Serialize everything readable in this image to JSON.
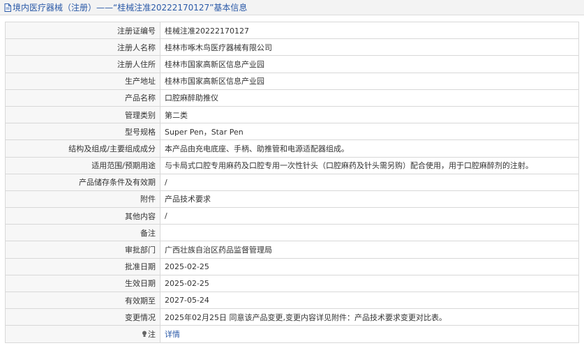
{
  "header": {
    "title": "境内医疗器械（注册）——“桂械注准20222170127”基本信息"
  },
  "rows": [
    {
      "label": "注册证编号",
      "value": "桂械注准20222170127"
    },
    {
      "label": "注册人名称",
      "value": "桂林市啄木鸟医疗器械有限公司"
    },
    {
      "label": "注册人住所",
      "value": "桂林市国家高新区信息产业园"
    },
    {
      "label": "生产地址",
      "value": "桂林市国家高新区信息产业园"
    },
    {
      "label": "产品名称",
      "value": "口腔麻醉助推仪"
    },
    {
      "label": "管理类别",
      "value": "第二类"
    },
    {
      "label": "型号规格",
      "value": "Super Pen，Star Pen"
    },
    {
      "label": "结构及组成/主要组成成分",
      "value": "本产品由充电底座、手柄、助推管和电源适配器组成。"
    },
    {
      "label": "适用范围/预期用途",
      "value": "与卡局式口腔专用麻药及口腔专用一次性针头（口腔麻药及针头需另购）配合使用，用于口腔麻醉剂的注射。"
    },
    {
      "label": "产品储存条件及有效期",
      "value": "/"
    },
    {
      "label": "附件",
      "value": "产品技术要求"
    },
    {
      "label": "其他内容",
      "value": "/"
    },
    {
      "label": "备注",
      "value": ""
    },
    {
      "label": "审批部门",
      "value": "广西壮族自治区药品监督管理局"
    },
    {
      "label": "批准日期",
      "value": "2025-02-25"
    },
    {
      "label": "生效日期",
      "value": "2025-02-25"
    },
    {
      "label": "有效期至",
      "value": "2027-05-24"
    },
    {
      "label": "变更情况",
      "value": "2025年02月25日 同意该产品变更,变更内容详见附件：产品技术要求变更对比表。"
    }
  ],
  "note": {
    "label": "注",
    "link_text": "详情"
  },
  "colors": {
    "header_text": "#2b5aa8",
    "link": "#2b5aa8",
    "label_bg": "#f7f7f7",
    "border": "#d8d8d8"
  }
}
